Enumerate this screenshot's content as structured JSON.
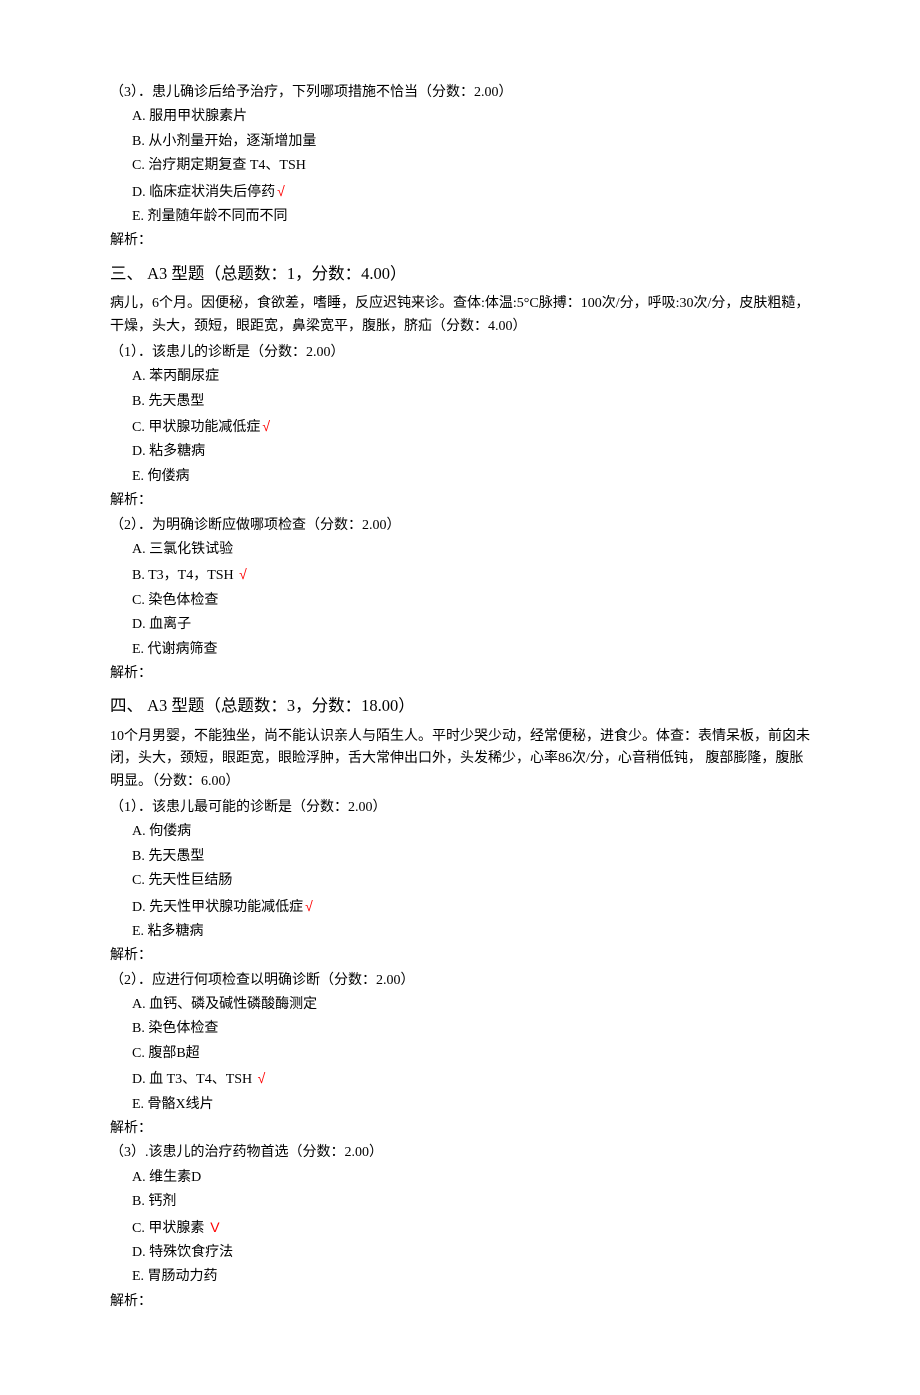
{
  "q1": {
    "header": "（3）．患儿确诊后给予治疗，下列哪项措施不恰当（分数：2.00）",
    "options": {
      "A": "A. 服用甲状腺素片",
      "B": "B. 从小剂量开始，逐渐增加量",
      "C": "C. 治疗期定期复查 T4、TSH",
      "D": "D. 临床症状消失后停药",
      "E": "E. 剂量随年龄不同而不同"
    },
    "correct": "√",
    "analysis": "解析："
  },
  "section3": {
    "title": "三、 A3 型题（总题数：1，分数：4.00）",
    "caseDesc": "病儿，6个月。因便秘，食欲差，嗜睡，反应迟钝来诊。查体:体温:5°C脉搏：100次/分，呼吸:30次/分，皮肤粗糙，干燥，头大，颈短，眼距宽，鼻梁宽平，腹胀，脐疝（分数：4.00）",
    "q1": {
      "header": "（1）．该患儿的诊断是（分数：2.00）",
      "options": {
        "A": "A. 苯丙酮尿症",
        "B": "B. 先天愚型",
        "C": "C. 甲状腺功能减低症",
        "D": "D. 粘多糖病",
        "E": "E. 佝偻病"
      },
      "correct": "√",
      "analysis": "解析："
    },
    "q2": {
      "header": "（2）．为明确诊断应做哪项检查（分数：2.00）",
      "options": {
        "A": "A. 三氯化铁试验",
        "B": "B. T3，T4，TSH ",
        "C": "C. 染色体检查",
        "D": "D. 血离子",
        "E": "E. 代谢病筛查"
      },
      "correct": "√",
      "analysis": "解析："
    }
  },
  "section4": {
    "title": "四、 A3 型题（总题数：3，分数：18.00）",
    "caseDesc": "10个月男婴，不能独坐，尚不能认识亲人与陌生人。平时少哭少动，经常便秘，进食少。体查：表情呆板，前囟未闭，头大，颈短，眼距宽，眼睑浮肿，舌大常伸出口外，头发稀少，心率86次/分，心音稍低钝， 腹部膨隆，腹胀明显。（分数：6.00）",
    "q1": {
      "header": "（1）．该患儿最可能的诊断是（分数：2.00）",
      "options": {
        "A": "A. 佝偻病",
        "B": "B. 先天愚型",
        "C": "C. 先天性巨结肠",
        "D": "D. 先天性甲状腺功能减低症",
        "E": "E. 粘多糖病"
      },
      "correct": "√",
      "analysis": "解析："
    },
    "q2": {
      "header": "（2）．应进行何项检查以明确诊断（分数：2.00）",
      "options": {
        "A": "A. 血钙、磷及碱性磷酸酶测定",
        "B": "B. 染色体检查",
        "C": "C. 腹部B超",
        "D": "D. 血 T3、T4、TSH ",
        "E": "E. 骨骼X线片"
      },
      "correct": "√",
      "analysis": "解析："
    },
    "q3": {
      "header": "（3）.该患儿的治疗药物首选（分数：2.00）",
      "options": {
        "A": "A. 维生素D",
        "B": "B. 钙剂",
        "C": "C. 甲状腺素",
        "D": "D. 特殊饮食疗法",
        "E": "E. 胃肠动力药"
      },
      "correct": " V",
      "analysis": "解析："
    }
  }
}
